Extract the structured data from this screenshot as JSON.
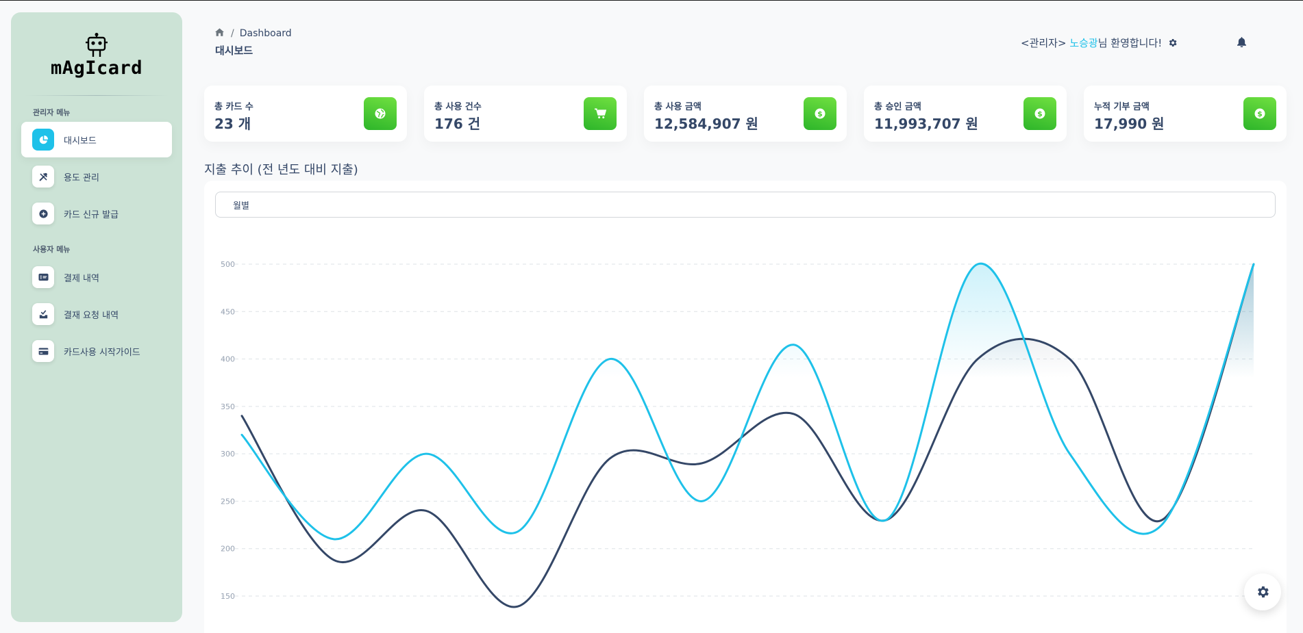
{
  "brand": {
    "logo_text": "mAgIcard"
  },
  "sidebar": {
    "admin_heading": "관리자 메뉴",
    "user_heading": "사용자 메뉴",
    "admin_items": [
      {
        "label": "대시보드",
        "icon": "pie-chart-icon",
        "active": true
      },
      {
        "label": "용도 관리",
        "icon": "tools-icon"
      },
      {
        "label": "카드 신규 발급",
        "icon": "plus-circle-icon"
      }
    ],
    "user_items": [
      {
        "label": "결제 내역",
        "icon": "receipt-icon"
      },
      {
        "label": "결재 요청 내역",
        "icon": "inbox-check-icon"
      },
      {
        "label": "카드사용 시작가이드",
        "icon": "credit-card-icon"
      }
    ]
  },
  "header": {
    "breadcrumb_current": "Dashboard",
    "page_title": "대시보드",
    "welcome_prefix": "<관리자> ",
    "welcome_name": "노승광",
    "welcome_suffix": "님 환영합니다!"
  },
  "stats": [
    {
      "label": "총 카드 수",
      "value": "23 개",
      "icon": "globe-icon"
    },
    {
      "label": "총 사용 건수",
      "value": "176 건",
      "icon": "cart-icon"
    },
    {
      "label": "총 사용 금액",
      "value": "12,584,907 원",
      "icon": "dollar-circle-icon"
    },
    {
      "label": "총 승인 금액",
      "value": "11,993,707 원",
      "icon": "dollar-circle-icon"
    },
    {
      "label": "누적 기부 금액",
      "value": "17,990 원",
      "icon": "dollar-circle-icon"
    }
  ],
  "chart_section": {
    "title": "지출 추이 (전 년도 대비 지출)",
    "select_value": "월별"
  },
  "colors": {
    "accent": "#1ec1e9",
    "dark": "#344767",
    "sidebar_bg": "#cce3d6",
    "stat_icon_green": "#4fcf32"
  },
  "chart_data": {
    "type": "line",
    "x": [
      1,
      2,
      3,
      4,
      5,
      6,
      7,
      8,
      9,
      10,
      11,
      12
    ],
    "ylim": [
      150,
      500
    ],
    "yticks": [
      150,
      200,
      250,
      300,
      350,
      400,
      450,
      500
    ],
    "grid": true,
    "series": [
      {
        "color": "#1ec1e9",
        "values": [
          320,
          210,
          300,
          218,
          400,
          250,
          415,
          230,
          500,
          300,
          225,
          500
        ]
      },
      {
        "color": "#344767",
        "values": [
          340,
          188,
          240,
          139,
          295,
          290,
          342,
          230,
          400,
          400,
          230,
          500
        ]
      }
    ]
  }
}
